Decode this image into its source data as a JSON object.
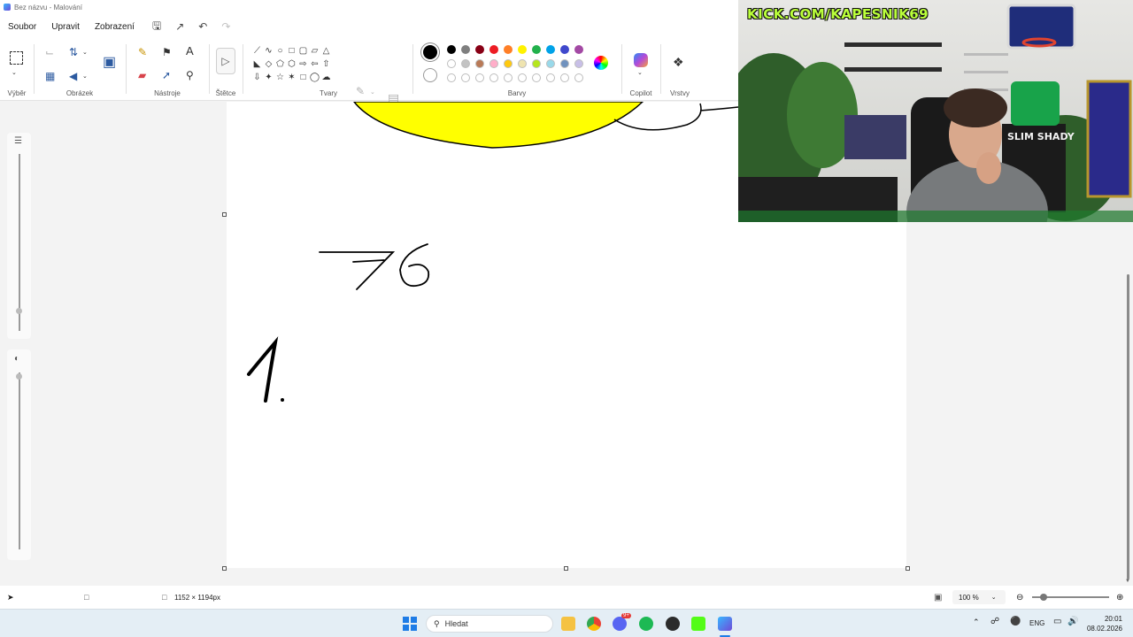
{
  "window": {
    "title": "Bez názvu - Malování"
  },
  "menu": {
    "items": [
      "Soubor",
      "Upravit",
      "Zobrazení"
    ]
  },
  "ribbon": {
    "groups": {
      "select": "Výběr",
      "image": "Obrázek",
      "tools": "Nástroje",
      "brushes": "Štětce",
      "shapes": "Tvary",
      "colors": "Barvy",
      "copilot": "Copilot",
      "layers": "Vrstvy"
    },
    "palette_row1": [
      "#000000",
      "#7f7f7f",
      "#880015",
      "#ed1c24",
      "#ff7f27",
      "#fff200",
      "#22b14c",
      "#00a2e8",
      "#3f48cc",
      "#a349a4"
    ],
    "palette_row2": [
      "#ffffff",
      "#c3c3c3",
      "#b97a57",
      "#ffaec9",
      "#ffc90e",
      "#efe4b0",
      "#b5e61d",
      "#99d9ea",
      "#7092be",
      "#c8bfe7"
    ],
    "color1": "#000000",
    "color2": "#ffffff"
  },
  "statusbar": {
    "canvas_size": "1152 × 1194px",
    "zoom": "100 %"
  },
  "taskbar": {
    "search_placeholder": "Hledat",
    "language": "ENG",
    "time": "20:01",
    "date": "08.02.2026",
    "notification_badge": "9+"
  },
  "stream_overlay": {
    "channel_text": "KICK.COM/KAPESNIK69"
  }
}
